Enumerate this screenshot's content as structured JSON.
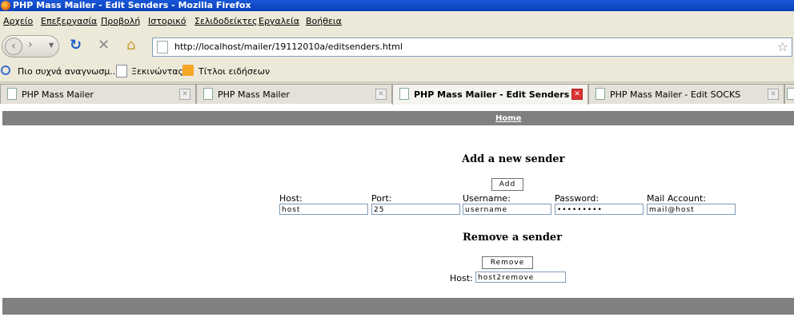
{
  "window": {
    "title": "PHP Mass Mailer - Edit Senders - Mozilla Firefox"
  },
  "menu": [
    "Αρχείο",
    "Επεξεργασία",
    "Προβολή",
    "Ιστορικό",
    "Σελιδοδείκτες",
    "Εργαλεία",
    "Βοήθεια"
  ],
  "nav": {
    "url": "http://localhost/mailer/19112010a/editsenders.html"
  },
  "bookmarks": [
    "Πιο συχνά αναγνωσμ...",
    "Ξεκινώντας",
    "Τίτλοι ειδήσεων"
  ],
  "tabs": [
    {
      "label": "PHP Mass Mailer",
      "active": false
    },
    {
      "label": "PHP Mass Mailer",
      "active": false
    },
    {
      "label": "PHP Mass Mailer - Edit Senders",
      "active": true
    },
    {
      "label": "PHP Mass Mailer - Edit SOCKS",
      "active": false
    }
  ],
  "page": {
    "home_link": "Home",
    "add_section": {
      "heading": "Add a new sender",
      "button": "Add",
      "fields": [
        {
          "label": "Host:",
          "value": "host"
        },
        {
          "label": "Port:",
          "value": "25"
        },
        {
          "label": "Username:",
          "value": "username"
        },
        {
          "label": "Password:",
          "value": "•••••••••"
        },
        {
          "label": "Mail Account:",
          "value": "mail@host"
        }
      ]
    },
    "remove_section": {
      "heading": "Remove a sender",
      "button": "Remove",
      "host_label": "Host:",
      "host_value": "host2remove"
    }
  }
}
